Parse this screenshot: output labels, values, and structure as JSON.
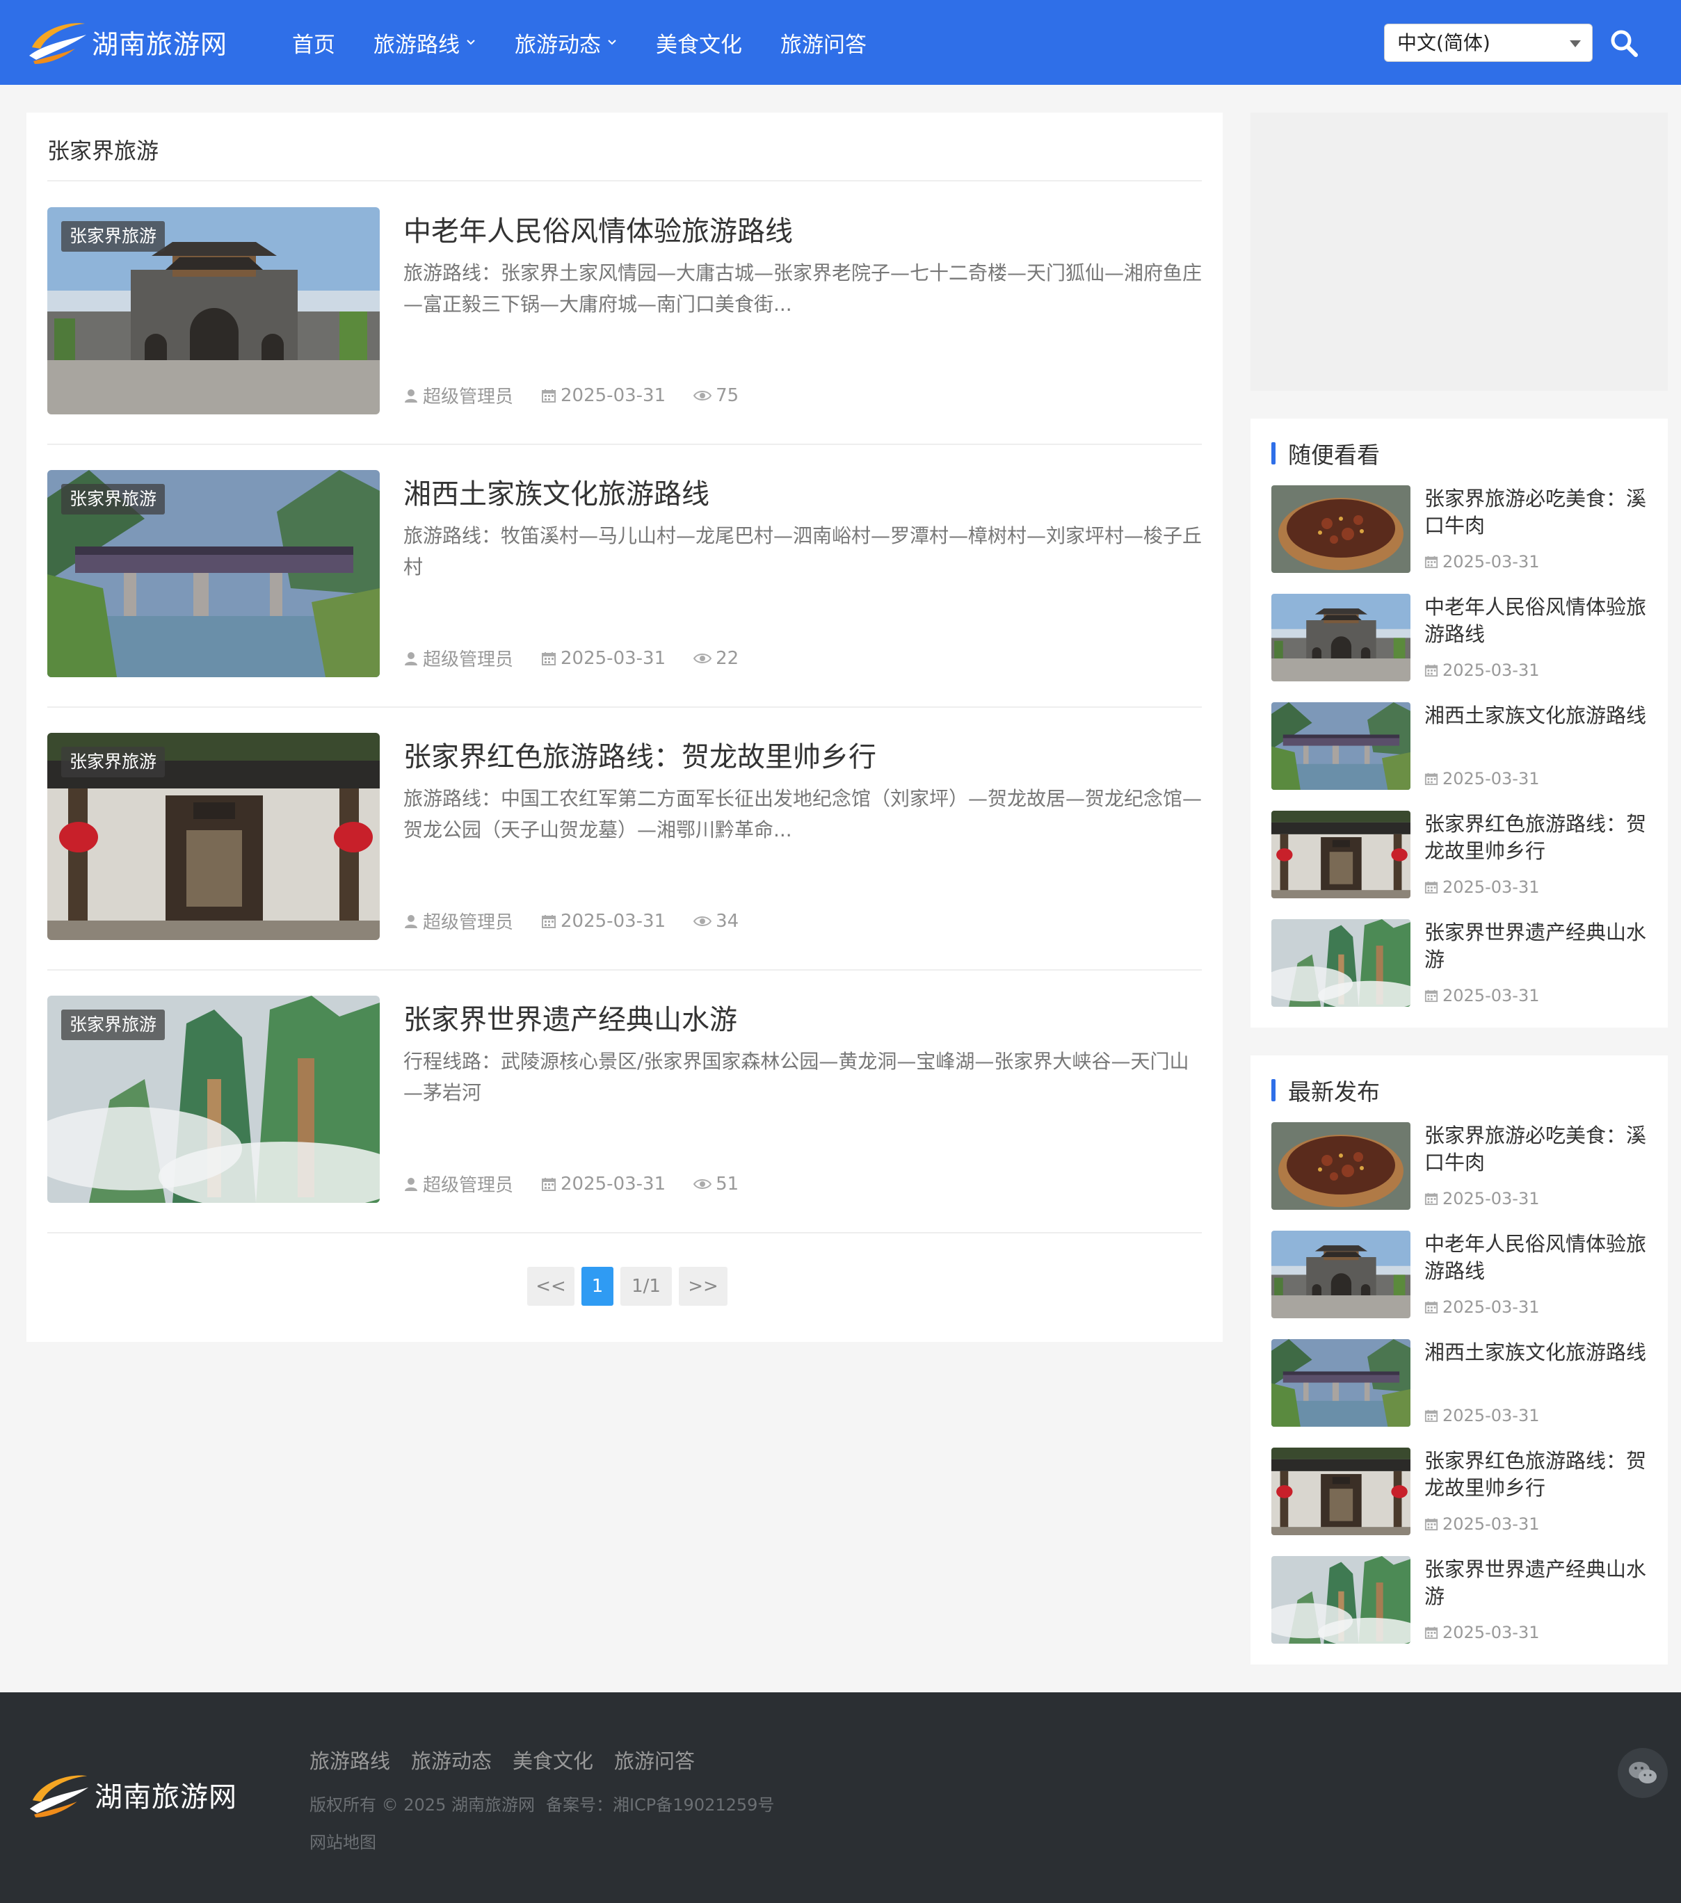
{
  "header": {
    "site_name": "湖南旅游网",
    "nav": [
      {
        "label": "首页",
        "dropdown": false
      },
      {
        "label": "旅游路线",
        "dropdown": true
      },
      {
        "label": "旅游动态",
        "dropdown": true
      },
      {
        "label": "美食文化",
        "dropdown": false
      },
      {
        "label": "旅游问答",
        "dropdown": false
      }
    ],
    "language": "中文(简体)",
    "accent_color": "#2f6fe8"
  },
  "main": {
    "section_title": "张家界旅游",
    "articles": [
      {
        "tag": "张家界旅游",
        "title": "中老年人民俗风情体验旅游路线",
        "desc": "旅游路线：张家界土家风情园—大庸古城—张家界老院子—七十二奇楼—天门狐仙—湘府鱼庄—富正毅三下锅—大庸府城—南门口美食街...",
        "author": "超级管理员",
        "date": "2025-03-31",
        "views": "75",
        "image": "city-gate"
      },
      {
        "tag": "张家界旅游",
        "title": "湘西土家族文化旅游路线",
        "desc": "旅游路线：牧笛溪村—马儿山村—龙尾巴村—泗南峪村—罗潭村—樟树村—刘家坪村—梭子丘村",
        "author": "超级管理员",
        "date": "2025-03-31",
        "views": "22",
        "image": "covered-bridge"
      },
      {
        "tag": "张家界旅游",
        "title": "张家界红色旅游路线：贺龙故里帅乡行",
        "desc": "旅游路线：中国工农红军第二方面军长征出发地纪念馆（刘家坪）—贺龙故居—贺龙纪念馆—贺龙公园（天子山贺龙墓）—湘鄂川黔革命...",
        "author": "超级管理员",
        "date": "2025-03-31",
        "views": "34",
        "image": "old-house"
      },
      {
        "tag": "张家界旅游",
        "title": "张家界世界遗产经典山水游",
        "desc": "行程线路：武陵源核心景区/张家界国家森林公园—黄龙洞—宝峰湖—张家界大峡谷—天门山—茅岩河",
        "author": "超级管理员",
        "date": "2025-03-31",
        "views": "51",
        "image": "misty-peaks"
      }
    ],
    "pagination": {
      "prev": "<<",
      "current": "1",
      "info": "1/1",
      "next": ">>"
    }
  },
  "sidebar": {
    "random": {
      "title": "随便看看",
      "items": [
        {
          "title": "张家界旅游必吃美食：溪口牛肉",
          "date": "2025-03-31",
          "image": "beef"
        },
        {
          "title": "中老年人民俗风情体验旅游路线",
          "date": "2025-03-31",
          "image": "city-gate"
        },
        {
          "title": "湘西土家族文化旅游路线",
          "date": "2025-03-31",
          "image": "covered-bridge"
        },
        {
          "title": "张家界红色旅游路线：贺龙故里帅乡行",
          "date": "2025-03-31",
          "image": "old-house"
        },
        {
          "title": "张家界世界遗产经典山水游",
          "date": "2025-03-31",
          "image": "misty-peaks"
        }
      ]
    },
    "latest": {
      "title": "最新发布",
      "items": [
        {
          "title": "张家界旅游必吃美食：溪口牛肉",
          "date": "2025-03-31",
          "image": "beef"
        },
        {
          "title": "中老年人民俗风情体验旅游路线",
          "date": "2025-03-31",
          "image": "city-gate"
        },
        {
          "title": "湘西土家族文化旅游路线",
          "date": "2025-03-31",
          "image": "covered-bridge"
        },
        {
          "title": "张家界红色旅游路线：贺龙故里帅乡行",
          "date": "2025-03-31",
          "image": "old-house"
        },
        {
          "title": "张家界世界遗产经典山水游",
          "date": "2025-03-31",
          "image": "misty-peaks"
        }
      ]
    }
  },
  "footer": {
    "site_name": "湖南旅游网",
    "nav": [
      "旅游路线",
      "旅游动态",
      "美食文化",
      "旅游问答"
    ],
    "copyright": "版权所有 © 2025 湖南旅游网",
    "icp": "备案号：湘ICP备19021259号",
    "sitemap": "网站地图",
    "wechat_icon": "wechat-icon"
  }
}
